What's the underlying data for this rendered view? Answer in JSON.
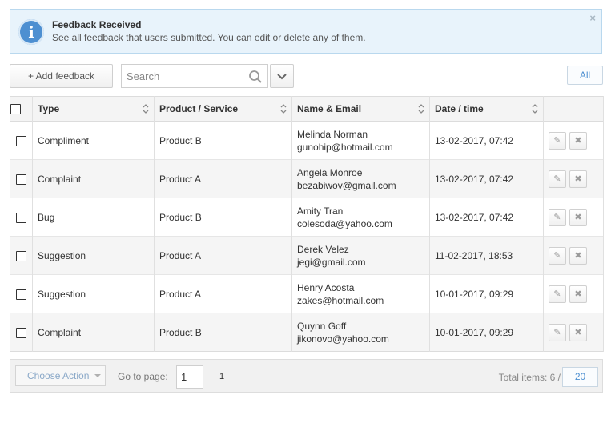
{
  "notice": {
    "title": "Feedback Received",
    "description": "See all feedback that users submitted. You can edit or delete any of them.",
    "close_glyph": "×",
    "icon": "info-icon",
    "icon_glyph": "i"
  },
  "toolbar": {
    "add_label": "+ Add feedback",
    "search_placeholder": "Search",
    "filter_label": "All"
  },
  "table": {
    "columns": [
      "Type",
      "Product / Service",
      "Name & Email",
      "Date / time"
    ],
    "rows": [
      {
        "type": "Compliment",
        "product": "Product B",
        "name": "Melinda Norman",
        "email": "gunohip@hotmail.com",
        "datetime": "13-02-2017, 07:42"
      },
      {
        "type": "Complaint",
        "product": "Product A",
        "name": "Angela Monroe",
        "email": "bezabiwov@gmail.com",
        "datetime": "13-02-2017, 07:42"
      },
      {
        "type": "Bug",
        "product": "Product B",
        "name": "Amity Tran",
        "email": "colesoda@yahoo.com",
        "datetime": "13-02-2017, 07:42"
      },
      {
        "type": "Suggestion",
        "product": "Product A",
        "name": "Derek Velez",
        "email": "jegi@gmail.com",
        "datetime": "11-02-2017, 18:53"
      },
      {
        "type": "Suggestion",
        "product": "Product A",
        "name": "Henry Acosta",
        "email": "zakes@hotmail.com",
        "datetime": "10-01-2017, 09:29"
      },
      {
        "type": "Complaint",
        "product": "Product B",
        "name": "Quynn Goff",
        "email": "jikonovo@yahoo.com",
        "datetime": "10-01-2017, 09:29"
      }
    ],
    "edit_glyph": "✎",
    "delete_glyph": "✖"
  },
  "footer": {
    "choose_action_label": "Choose Action",
    "goto_label": "Go to page:",
    "page_value": "1",
    "page_count": "1",
    "total_label": "Total items: 6 /",
    "per_page": "20"
  },
  "colors": {
    "accent": "#4d8fd1",
    "notice_bg": "#e8f3fb",
    "notice_border": "#b9d8ee"
  }
}
